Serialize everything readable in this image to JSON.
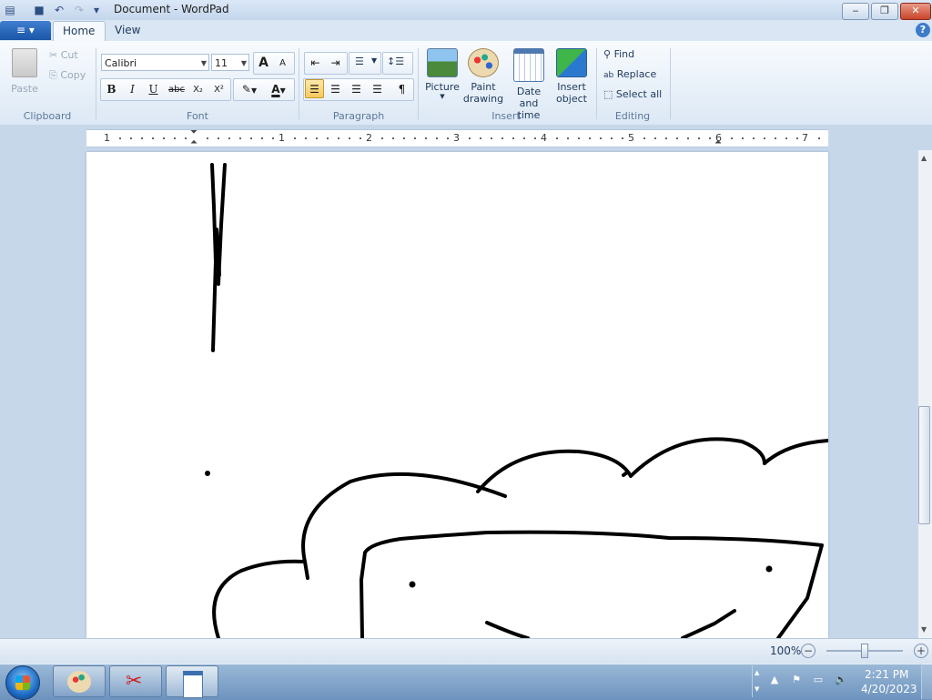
{
  "window": {
    "title": "Document - WordPad"
  },
  "quick_access": {
    "icons": [
      "app-icon",
      "save-icon",
      "undo-icon",
      "redo-icon",
      "customize-icon"
    ]
  },
  "tabs": {
    "app_menu_icon": "≡ ▾",
    "home": "Home",
    "view": "View",
    "help_icon": "?"
  },
  "clipboard": {
    "paste": "Paste",
    "cut": "Cut",
    "copy": "Copy",
    "group": "Clipboard"
  },
  "font": {
    "family": "Calibri",
    "size": "11",
    "grow": "A",
    "shrink": "A",
    "bold": "B",
    "italic": "I",
    "underline": "U",
    "strikethrough": "abc",
    "subscript": "X₂",
    "superscript": "X²",
    "font_color": "A",
    "group": "Font"
  },
  "paragraph": {
    "group": "Paragraph"
  },
  "insert": {
    "picture": "Picture",
    "paint_drawing_1": "Paint",
    "paint_drawing_2": "drawing",
    "date_time_1": "Date and",
    "date_time_2": "time",
    "insert_object_1": "Insert",
    "insert_object_2": "object",
    "group": "Insert"
  },
  "editing": {
    "find": "Find",
    "replace": "Replace",
    "select_all": "Select all",
    "group": "Editing"
  },
  "ruler": {
    "numbers": [
      "1",
      "1",
      "2",
      "3",
      "4",
      "5",
      "6",
      "7"
    ]
  },
  "status": {
    "zoom": "100%"
  },
  "taskbar": {
    "time": "2:21 PM",
    "date": "4/20/2023"
  },
  "colors": {
    "accent": "#1b56a8",
    "ribbon": "#dce8f5",
    "page": "#ffffff",
    "ink": "#000000"
  }
}
